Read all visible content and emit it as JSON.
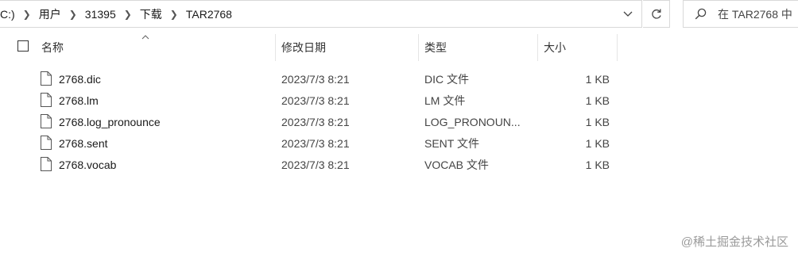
{
  "address": {
    "segments": [
      "C:)",
      "用户",
      "31395",
      "下载",
      "TAR2768"
    ]
  },
  "search": {
    "placeholder": "在 TAR2768 中"
  },
  "columns": {
    "name": "名称",
    "date": "修改日期",
    "type": "类型",
    "size": "大小"
  },
  "files": [
    {
      "name": "2768.dic",
      "date": "2023/7/3 8:21",
      "type": "DIC 文件",
      "size": "1 KB"
    },
    {
      "name": "2768.lm",
      "date": "2023/7/3 8:21",
      "type": "LM 文件",
      "size": "1 KB"
    },
    {
      "name": "2768.log_pronounce",
      "date": "2023/7/3 8:21",
      "type": "LOG_PRONOUN...",
      "size": "1 KB"
    },
    {
      "name": "2768.sent",
      "date": "2023/7/3 8:21",
      "type": "SENT 文件",
      "size": "1 KB"
    },
    {
      "name": "2768.vocab",
      "date": "2023/7/3 8:21",
      "type": "VOCAB 文件",
      "size": "1 KB"
    }
  ],
  "watermark": "@稀土掘金技术社区",
  "icons": [
    "chevron-right-icon",
    "chevron-down-icon",
    "refresh-icon",
    "search-icon",
    "sort-up-icon",
    "file-icon"
  ]
}
